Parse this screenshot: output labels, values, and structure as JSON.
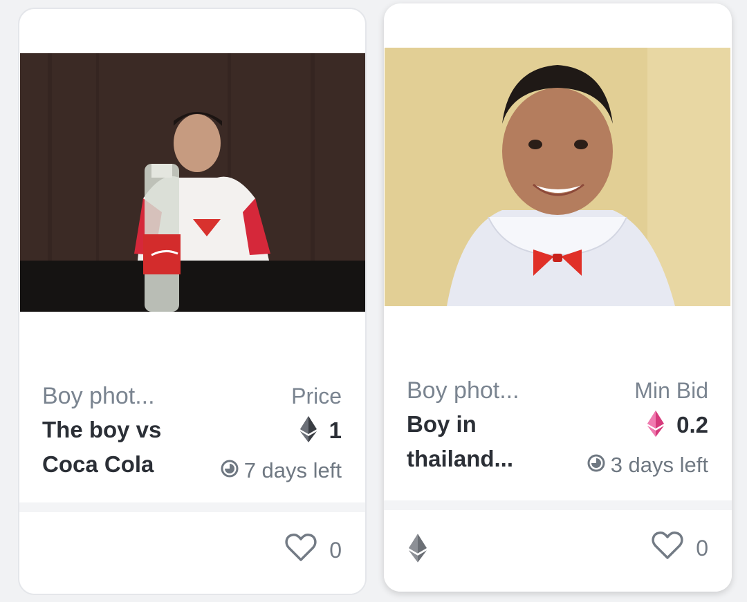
{
  "cards": [
    {
      "collection": "Boy phot...",
      "title": "The boy vs Coca Cola",
      "price_label": "Price",
      "price_value": "1",
      "currency_icon": "ethereum-icon",
      "time_left": "7 days left",
      "likes": "0"
    },
    {
      "collection": "Boy phot...",
      "title": "Boy in thailand...",
      "price_label": "Min Bid",
      "price_value": "0.2",
      "currency_icon": "ethereum-icon",
      "currency_color": "#e8458b",
      "time_left": "3 days left",
      "likes": "0"
    }
  ]
}
